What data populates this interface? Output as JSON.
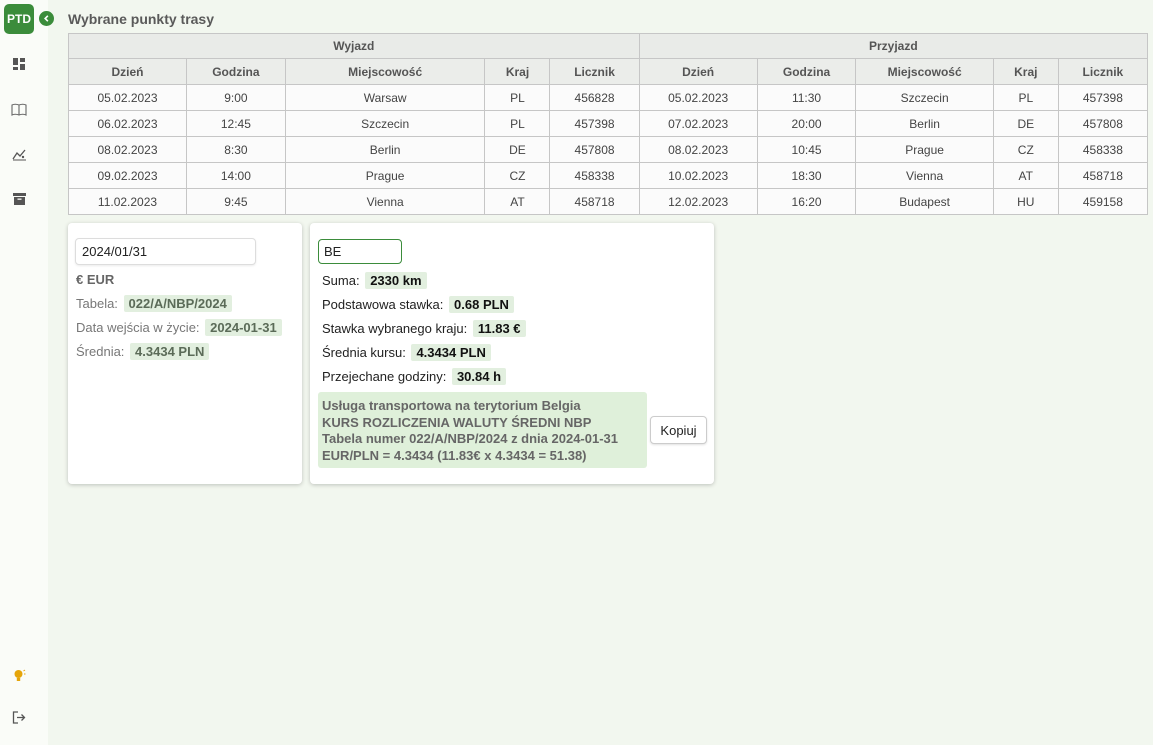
{
  "app": {
    "logo": "PTD"
  },
  "sidebar": {
    "items": [
      {
        "icon": "dashboard-icon"
      },
      {
        "icon": "book-icon"
      },
      {
        "icon": "chart-icon"
      },
      {
        "icon": "archive-icon"
      }
    ],
    "bottom": [
      {
        "icon": "lightbulb-icon"
      },
      {
        "icon": "logout-icon"
      }
    ]
  },
  "page": {
    "title": "Wybrane punkty trasy"
  },
  "table": {
    "group_departure": "Wyjazd",
    "group_arrival": "Przyjazd",
    "columns": [
      "Dzień",
      "Godzina",
      "Miejscowość",
      "Kraj",
      "Licznik",
      "Dzień",
      "Godzina",
      "Miejscowość",
      "Kraj",
      "Licznik"
    ],
    "rows": [
      [
        "05.02.2023",
        "9:00",
        "Warsaw",
        "PL",
        "456828",
        "05.02.2023",
        "11:30",
        "Szczecin",
        "PL",
        "457398"
      ],
      [
        "06.02.2023",
        "12:45",
        "Szczecin",
        "PL",
        "457398",
        "07.02.2023",
        "20:00",
        "Berlin",
        "DE",
        "457808"
      ],
      [
        "08.02.2023",
        "8:30",
        "Berlin",
        "DE",
        "457808",
        "08.02.2023",
        "10:45",
        "Prague",
        "CZ",
        "458338"
      ],
      [
        "09.02.2023",
        "14:00",
        "Prague",
        "CZ",
        "458338",
        "10.02.2023",
        "18:30",
        "Vienna",
        "AT",
        "458718"
      ],
      [
        "11.02.2023",
        "9:45",
        "Vienna",
        "AT",
        "458718",
        "12.02.2023",
        "16:20",
        "Budapest",
        "HU",
        "459158"
      ]
    ]
  },
  "rate_card": {
    "date_value": "2024/01/31",
    "currency": "€ EUR",
    "table_label": "Tabela:",
    "table_value": "022/A/NBP/2024",
    "effective_label": "Data wejścia w życie:",
    "effective_value": "2024-01-31",
    "average_label": "Średnia:",
    "average_value": "4.3434 PLN"
  },
  "calc_card": {
    "country_value": "BE",
    "sum_label": "Suma:",
    "sum_value": "2330 km",
    "base_rate_label": "Podstawowa stawka:",
    "base_rate_value": "0.68 PLN",
    "country_rate_label": "Stawka wybranego kraju:",
    "country_rate_value": "11.83 €",
    "avg_rate_label": "Średnia kursu:",
    "avg_rate_value": "4.3434 PLN",
    "hours_label": "Przejechane godziny:",
    "hours_value": "30.84 h",
    "summary_line1": "Usługa transportowa na terytorium Belgia",
    "summary_line2": "KURS ROZLICZENIA WALUTY ŚREDNI NBP",
    "summary_line3": "Tabela numer 022/A/NBP/2024 z dnia 2024-01-31",
    "summary_line4": "EUR/PLN = 4.3434 (11.83€ x 4.3434 = 51.38)",
    "copy_label": "Kopiuj"
  },
  "colors": {
    "accent": "#3b8c3b",
    "chip_bg": "#e2efdf",
    "page_bg": "#f2f7ef"
  }
}
